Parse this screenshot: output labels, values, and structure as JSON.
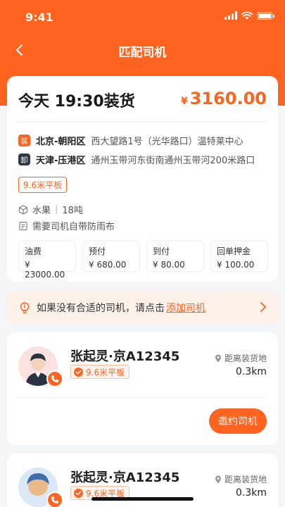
{
  "status_bar": {
    "time": "9:41"
  },
  "nav": {
    "title": "匹配司机"
  },
  "order": {
    "load_time": "今天 19:30装货",
    "price_currency": "¥",
    "price": "3160.00",
    "load": {
      "tag": "装",
      "city": "北京-朝阳区",
      "address": "西大望路1号（光华路口）温特莱中心"
    },
    "unload": {
      "tag": "卸",
      "city": "天津-压港区",
      "address": "通州玉带河东街南通州玉带河200米路口"
    },
    "truck_type": "9.6米平板",
    "cargo_name": "水果",
    "cargo_weight": "18吨",
    "note": "需要司机自带防雨布",
    "fees": [
      {
        "label": "油费",
        "value": "¥ 23000.00"
      },
      {
        "label": "预付",
        "value": "¥ 680.00"
      },
      {
        "label": "到付",
        "value": "¥ 80.00"
      },
      {
        "label": "回单押金",
        "value": "¥ 100.00"
      }
    ]
  },
  "tip": {
    "text": "如果没有合适的司机，请点击",
    "link": "添加司机"
  },
  "drivers": [
    {
      "name": "张起灵·京A12345",
      "truck": "9.6米平板",
      "distance_label": "距离装货地",
      "distance": "0.3km",
      "invite_label": "邀约司机"
    },
    {
      "name": "张起灵·京A12345",
      "truck": "9.6米平板",
      "distance_label": "距离装货地",
      "distance": "0.3km"
    }
  ],
  "colors": {
    "brand": "#fe6420",
    "background": "#f4f5f7"
  }
}
